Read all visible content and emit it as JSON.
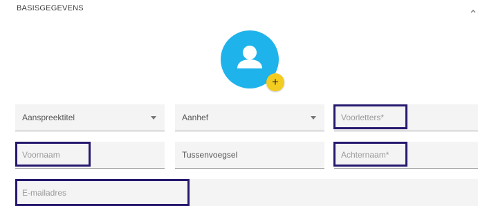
{
  "section": {
    "title": "BASISGEGEVENS",
    "collapse_icon": "chevron-up-icon"
  },
  "avatar": {
    "icon": "person-icon",
    "color": "#1FB3EC",
    "add_icon": "plus-icon",
    "add_label": "+",
    "add_color": "#F2CC20"
  },
  "fields": {
    "aanspreektitel": {
      "label": "Aanspreektitel",
      "type": "select"
    },
    "aanhef": {
      "label": "Aanhef",
      "type": "select"
    },
    "voorletters": {
      "placeholder": "Voorletters*"
    },
    "voornaam": {
      "placeholder": "Voornaam"
    },
    "tussenvoegsel": {
      "label": "Tussenvoegsel"
    },
    "achternaam": {
      "placeholder": "Achternaam*"
    },
    "email": {
      "placeholder": "E-mailadres"
    }
  },
  "highlight_color": "#24186E"
}
